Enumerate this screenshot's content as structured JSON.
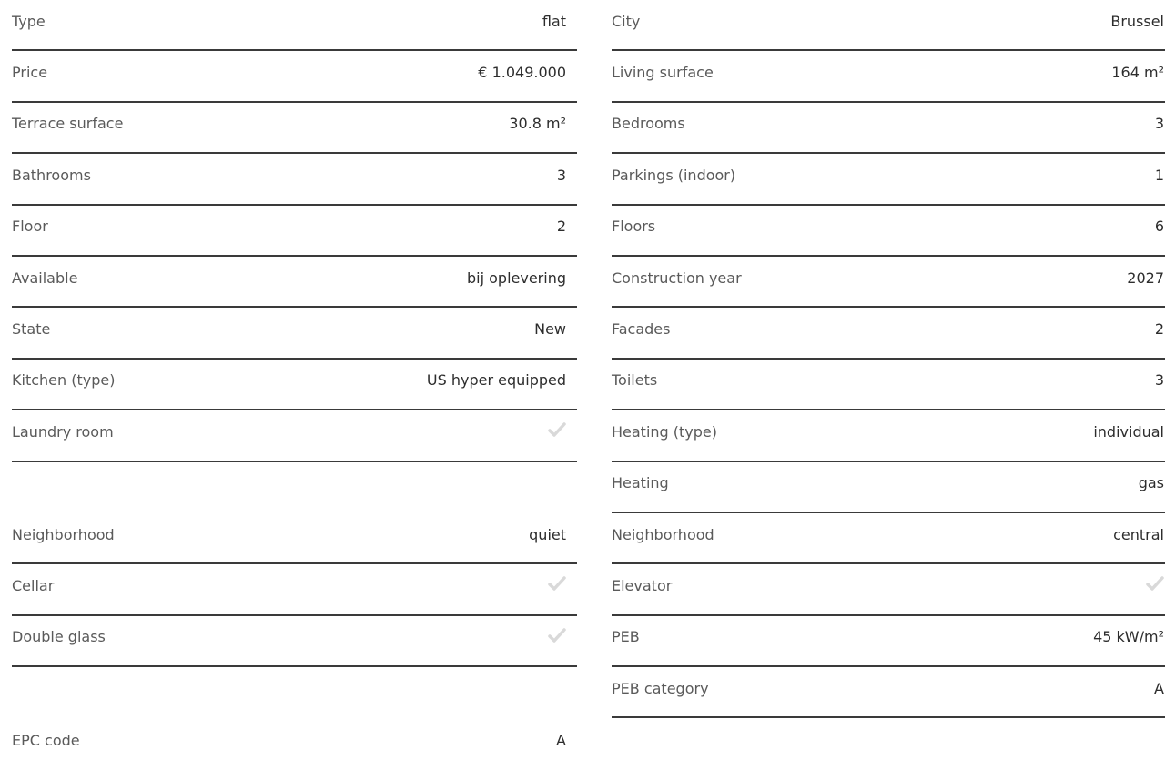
{
  "left_column": {
    "rows": [
      {
        "label": "Type",
        "value": "flat"
      },
      {
        "label": "Price",
        "value": "€ 1.049.000"
      },
      {
        "label": "Terrace surface",
        "value": "30.8 m²"
      },
      {
        "label": "Bathrooms",
        "value": "3"
      },
      {
        "label": "Floor",
        "value": "2"
      },
      {
        "label": "Available",
        "value": "bij oplevering"
      },
      {
        "label": "State",
        "value": "New"
      },
      {
        "label": "Kitchen (type)",
        "value": "US hyper equipped"
      },
      {
        "label": "Laundry room",
        "icon": "check-icon"
      },
      {
        "label": "Neighborhood",
        "value": "quiet"
      },
      {
        "label": "Cellar",
        "icon": "check-icon"
      },
      {
        "label": "Double glass",
        "icon": "check-icon"
      },
      {
        "label": "EPC code",
        "value": "A"
      }
    ]
  },
  "right_column": {
    "rows": [
      {
        "label": "City",
        "value": "Brussel"
      },
      {
        "label": "Living surface",
        "value": "164 m²"
      },
      {
        "label": "Bedrooms",
        "value": "3"
      },
      {
        "label": "Parkings (indoor)",
        "value": "1"
      },
      {
        "label": "Floors",
        "value": "6"
      },
      {
        "label": "Construction year",
        "value": "2027"
      },
      {
        "label": "Facades",
        "value": "2"
      },
      {
        "label": "Toilets",
        "value": "3"
      },
      {
        "label": "Heating (type)",
        "value": "individual"
      },
      {
        "label": "Heating",
        "value": "gas"
      },
      {
        "label": "Neighborhood",
        "value": "central"
      },
      {
        "label": "Elevator",
        "icon": "check-icon"
      },
      {
        "label": "PEB",
        "value": "45 kW/m²"
      },
      {
        "label": "PEB category",
        "value": "A"
      }
    ]
  },
  "colors": {
    "label": "#5a5a5a",
    "value": "#2d2d2d",
    "divider": "#3a3a3a",
    "check": "#d9d9d9"
  }
}
